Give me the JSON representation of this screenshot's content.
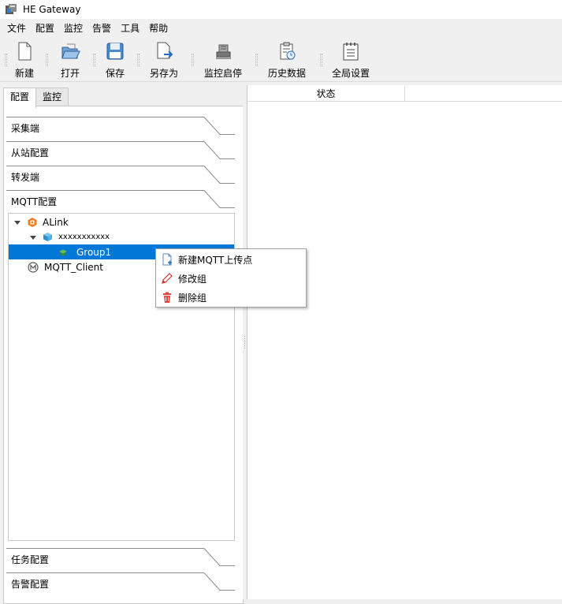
{
  "window": {
    "title": "HE Gateway"
  },
  "menubar": {
    "items": [
      "文件",
      "配置",
      "监控",
      "告警",
      "工具",
      "帮助"
    ]
  },
  "toolbar": {
    "new_label": "新建",
    "open_label": "打开",
    "save_label": "保存",
    "save_as_label": "另存为",
    "monitor_toggle_label": "监控启停",
    "history_label": "历史数据",
    "global_settings_label": "全局设置"
  },
  "left_tabs": {
    "config": "配置",
    "monitor": "监控",
    "active": "配置"
  },
  "sections": {
    "collector": "采集端",
    "slave": "从站配置",
    "forward": "转发端",
    "mqtt": "MQTT配置",
    "task": "任务配置",
    "alarm": "告警配置"
  },
  "tree": {
    "alink": "ALink",
    "device": "xxxxxxxxxxx",
    "group": "Group1",
    "mqtt_client": "MQTT_Client",
    "selected": "Group1"
  },
  "right_panel": {
    "status_header": "状态"
  },
  "context_menu": {
    "new_point": "新建MQTT上传点",
    "modify_group": "修改组",
    "delete_group": "删除组"
  },
  "colors": {
    "selection": "#0078d7",
    "alink_icon": "#f07c1e",
    "delete_icon": "#e0453c"
  }
}
